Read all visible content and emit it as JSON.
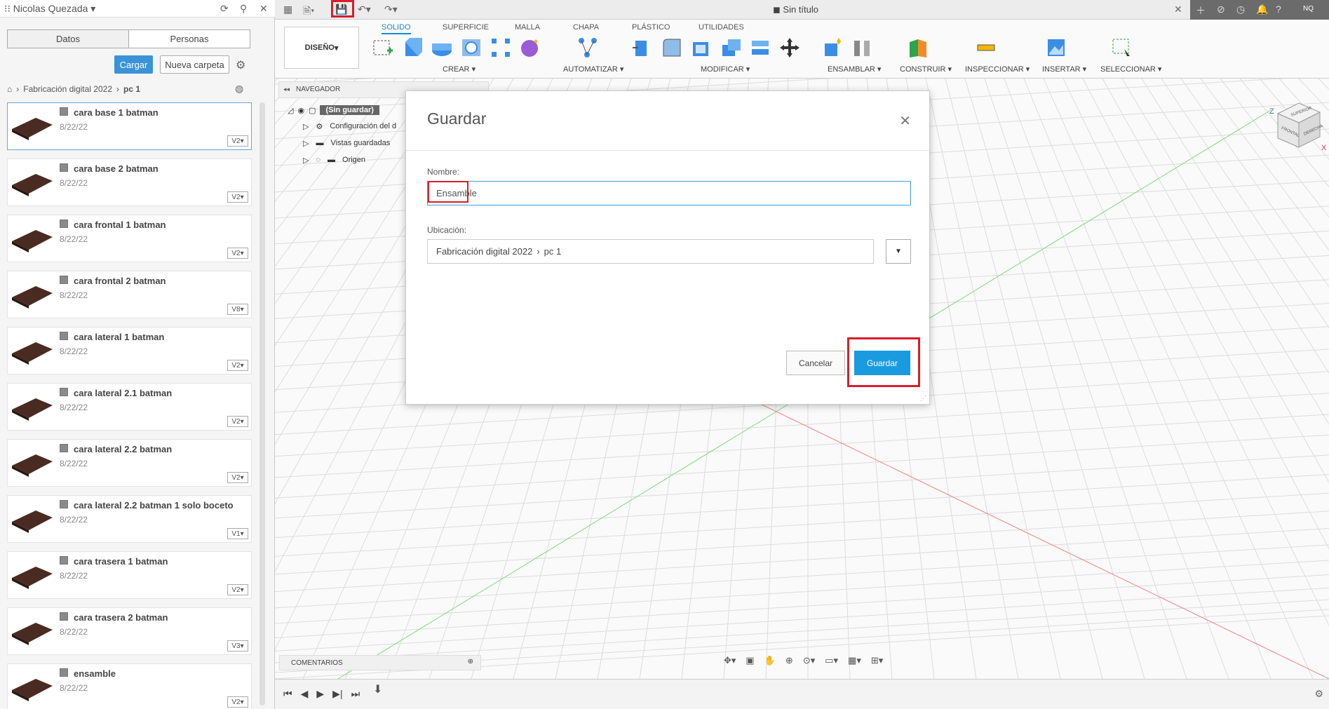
{
  "user": {
    "name": "Nicolas Quezada",
    "initials": "NQ"
  },
  "data_panel": {
    "tabs": [
      "Datos",
      "Personas"
    ],
    "upload_label": "Cargar",
    "new_folder_label": "Nueva carpeta",
    "breadcrumb": [
      "Fabricación digital 2022",
      "pc 1"
    ],
    "files": [
      {
        "name": "cara base 1 batman",
        "date": "8/22/22",
        "version": "V2"
      },
      {
        "name": "cara base 2 batman",
        "date": "8/22/22",
        "version": "V2"
      },
      {
        "name": "cara frontal 1 batman",
        "date": "8/22/22",
        "version": "V2"
      },
      {
        "name": "cara frontal 2 batman",
        "date": "8/22/22",
        "version": "V8"
      },
      {
        "name": "cara lateral 1 batman",
        "date": "8/22/22",
        "version": "V2"
      },
      {
        "name": "cara lateral 2.1 batman",
        "date": "8/22/22",
        "version": "V2"
      },
      {
        "name": "cara lateral 2.2 batman",
        "date": "8/22/22",
        "version": "V2"
      },
      {
        "name": "cara lateral 2.2 batman 1 solo boceto",
        "date": "8/22/22",
        "version": "V1"
      },
      {
        "name": "cara trasera 1 batman",
        "date": "8/22/22",
        "version": "V2"
      },
      {
        "name": "cara trasera 2 batman",
        "date": "8/22/22",
        "version": "V3"
      },
      {
        "name": "ensamble",
        "date": "8/22/22",
        "version": "V2"
      }
    ]
  },
  "window": {
    "doc_title": "Sin título"
  },
  "ribbon": {
    "design_label": "DISEÑO",
    "tabs": [
      "SOLIDO",
      "SUPERFICIE",
      "MALLA",
      "CHAPA",
      "PLÁSTICO",
      "UTILIDADES"
    ],
    "groups": [
      "CREAR",
      "AUTOMATIZAR",
      "MODIFICAR",
      "ENSAMBLAR",
      "CONSTRUIR",
      "INSPECCIONAR",
      "INSERTAR",
      "SELECCIONAR"
    ]
  },
  "navigator": {
    "title": "NAVEGADOR",
    "root": "(Sin guardar)",
    "items": [
      "Configuración del d",
      "Vistas guardadas",
      "Origen"
    ],
    "comments": "COMENTARIOS"
  },
  "dialog": {
    "title": "Guardar",
    "name_label": "Nombre:",
    "name_value": "Ensamble",
    "location_label": "Ubicación:",
    "location_path": [
      "Fabricación  digital 2022",
      "pc 1"
    ],
    "cancel_label": "Cancelar",
    "save_label": "Guardar"
  },
  "viewcube": {
    "faces": [
      "SUPERIOR",
      "FRONTAL",
      "DERECHA"
    ],
    "axes": [
      "Z",
      "X"
    ]
  },
  "colors": {
    "accent": "#1a9be0",
    "highlight": "#d81e2a",
    "thumb": "#4a2b22"
  }
}
